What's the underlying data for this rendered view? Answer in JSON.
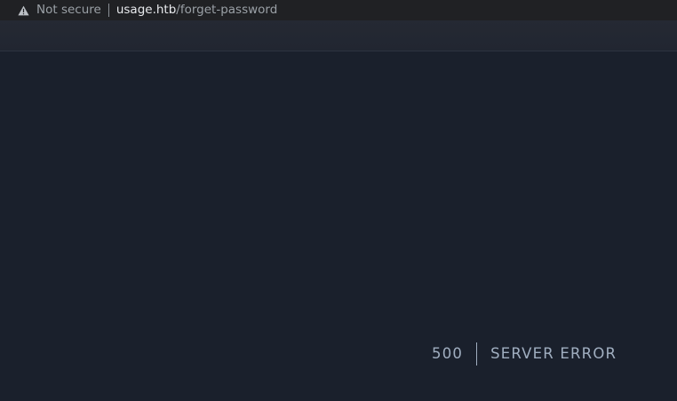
{
  "browser": {
    "security_label": "Not secure",
    "url_host": "usage.htb",
    "url_path": "/forget-password",
    "warning_icon": "warning-triangle-icon"
  },
  "error": {
    "code": "500",
    "message": "SERVER ERROR"
  },
  "colors": {
    "page_background": "#1a202c",
    "error_text": "#a0aec0",
    "browser_bar": "#202124"
  }
}
